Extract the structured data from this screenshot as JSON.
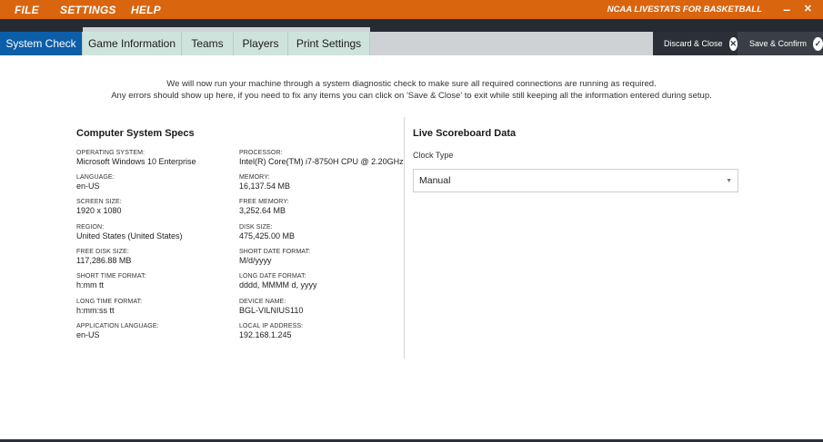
{
  "menu": {
    "file": "FILE",
    "settings": "SETTINGS",
    "help": "HELP"
  },
  "app_title": "NCAA LIVESTATS FOR BASKETBALL",
  "window": {
    "minimize": "–",
    "close": "✕"
  },
  "tabs": [
    {
      "label": "System Check",
      "active": true
    },
    {
      "label": "Game Information",
      "active": false
    },
    {
      "label": "Teams",
      "active": false
    },
    {
      "label": "Players",
      "active": false
    },
    {
      "label": "Print Settings",
      "active": false
    }
  ],
  "actions": {
    "discard_label": "Discard & Close",
    "discard_icon": "close-circle-icon",
    "confirm_label": "Save & Confirm",
    "confirm_icon": "check-circle-icon"
  },
  "intro": {
    "line1": "We will now run your machine through a system diagnostic check to make sure all required connections are running as required.",
    "line2": "Any errors should show up here, if you need to fix any items you can click on 'Save & Close' to exit while still keeping all the information entered during setup."
  },
  "specs": {
    "title": "Computer System Specs",
    "left": [
      {
        "label": "OPERATING SYSTEM:",
        "value": "Microsoft Windows 10 Enterprise"
      },
      {
        "label": "LANGUAGE:",
        "value": "en-US"
      },
      {
        "label": "SCREEN SIZE:",
        "value": "1920 x 1080"
      },
      {
        "label": "REGION:",
        "value": "United States (United States)"
      },
      {
        "label": "FREE DISK SIZE:",
        "value": "117,286.88 MB"
      },
      {
        "label": "SHORT TIME FORMAT:",
        "value": "h:mm tt"
      },
      {
        "label": "LONG TIME FORMAT:",
        "value": "h:mm:ss tt"
      },
      {
        "label": "APPLICATION LANGUAGE:",
        "value": "en-US"
      }
    ],
    "right": [
      {
        "label": "PROCESSOR:",
        "value": "Intel(R) Core(TM) i7-8750H CPU @ 2.20GHz"
      },
      {
        "label": "MEMORY:",
        "value": "16,137.54 MB"
      },
      {
        "label": "FREE MEMORY:",
        "value": "3,252.64 MB"
      },
      {
        "label": "DISK SIZE:",
        "value": "475,425.00 MB"
      },
      {
        "label": "SHORT DATE FORMAT:",
        "value": "M/d/yyyy"
      },
      {
        "label": "LONG DATE FORMAT:",
        "value": "dddd, MMMM d, yyyy"
      },
      {
        "label": "DEVICE NAME:",
        "value": "BGL-VILNIUS110"
      },
      {
        "label": "LOCAL IP ADDRESS:",
        "value": "192.168.1.245"
      }
    ]
  },
  "scoreboard": {
    "title": "Live Scoreboard Data",
    "clock_type_label": "Clock Type",
    "clock_type_value": "Manual"
  },
  "colors": {
    "menu_bar": "#d9650f",
    "active_tab": "#0d5ea8",
    "inactive_tab": "#cfe3dd",
    "dark": "#2b3038"
  }
}
